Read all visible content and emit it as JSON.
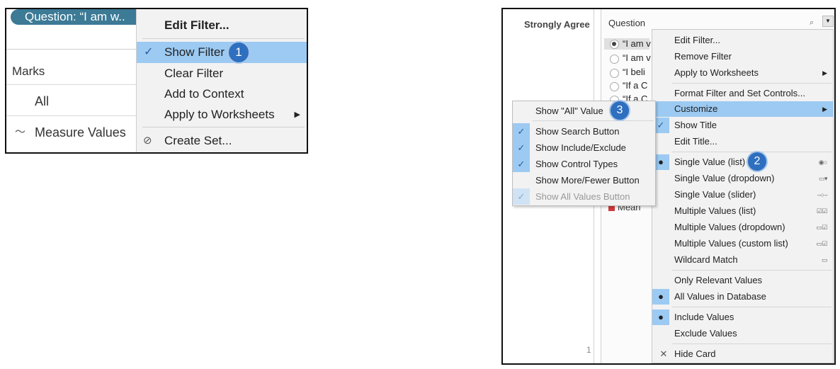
{
  "left": {
    "pill_text": "Question: “I am w..",
    "marks_label": "Marks",
    "all_label": "All",
    "measure_values_label": "Measure Values",
    "menu": {
      "edit_filter": "Edit Filter...",
      "show_filter": "Show Filter",
      "clear_filter": "Clear Filter",
      "add_to_context": "Add to Context",
      "apply_to_worksheets": "Apply to Worksheets",
      "create_set": "Create Set..."
    },
    "badge": "1"
  },
  "right": {
    "column_header": "Strongly Agree",
    "row_number": "1",
    "card_title": "Question",
    "list_items": [
      "“I am v",
      "“I am v",
      "“I beli",
      "“If a C",
      "“If a C"
    ],
    "legend_mean": "Mean",
    "menu": {
      "edit_filter": "Edit Filter...",
      "remove_filter": "Remove Filter",
      "apply_to_worksheets": "Apply to Worksheets",
      "format_filter": "Format Filter and Set Controls...",
      "customize": "Customize",
      "show_title": "Show Title",
      "edit_title": "Edit Title...",
      "single_value_list": "Single Value (list)",
      "single_value_dropdown": "Single Value (dropdown)",
      "single_value_slider": "Single Value (slider)",
      "multiple_values_list": "Multiple Values (list)",
      "multiple_values_dropdown": "Multiple Values (dropdown)",
      "multiple_values_custom": "Multiple Values (custom list)",
      "wildcard_match": "Wildcard Match",
      "only_relevant": "Only Relevant Values",
      "all_values_db": "All Values in Database",
      "include_values": "Include Values",
      "exclude_values": "Exclude Values",
      "hide_card": "Hide Card"
    },
    "submenu": {
      "show_all_value": "Show \"All\" Value",
      "show_search_button": "Show Search Button",
      "show_include_exclude": "Show Include/Exclude",
      "show_control_types": "Show Control Types",
      "show_more_fewer": "Show More/Fewer Button",
      "show_all_values_button": "Show All Values Button"
    },
    "badge2": "2",
    "badge3": "3"
  },
  "colors": {
    "highlight": "#9ccaf2",
    "pill": "#3c7a96",
    "badge": "#2f6fbf"
  }
}
